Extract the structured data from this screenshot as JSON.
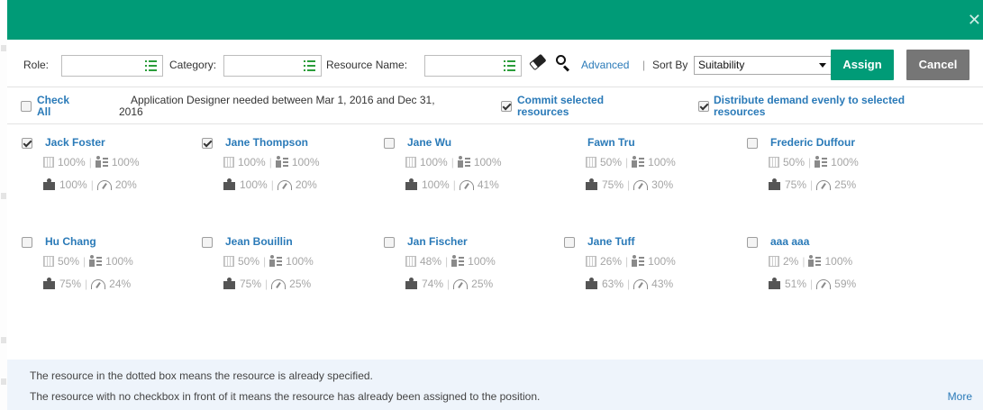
{
  "toolbar": {
    "role_label": "Role:",
    "category_label": "Category:",
    "resource_name_label": "Resource Name:",
    "advanced_label": "Advanced",
    "divider": "|",
    "sort_by_label": "Sort By",
    "sort_value": "Suitability",
    "assign_label": "Assign",
    "cancel_label": "Cancel",
    "icons": [
      "list-picker-icon",
      "eraser-icon",
      "search-icon"
    ]
  },
  "options": {
    "check_all_line1": "Check",
    "check_all_line2": "All",
    "demand_line1": "Application Designer needed between Mar 1, 2016 and Dec 31,",
    "demand_line2": "2016",
    "commit_line1": "Commit selected",
    "commit_line2": "resources",
    "commit_checked": true,
    "distribute_line1": "Distribute demand evenly to selected",
    "distribute_line2": "resources",
    "distribute_checked": true
  },
  "resources": [
    {
      "name": "Jack Foster",
      "checked": true,
      "has_checkbox": true,
      "availability": "100%",
      "skills": "100%",
      "match": "100%",
      "performance": "20%"
    },
    {
      "name": "Jane Thompson",
      "checked": true,
      "has_checkbox": true,
      "availability": "100%",
      "skills": "100%",
      "match": "100%",
      "performance": "20%"
    },
    {
      "name": "Jane Wu",
      "checked": false,
      "has_checkbox": true,
      "availability": "100%",
      "skills": "100%",
      "match": "100%",
      "performance": "41%"
    },
    {
      "name": "Fawn Tru",
      "checked": false,
      "has_checkbox": false,
      "availability": "50%",
      "skills": "100%",
      "match": "75%",
      "performance": "30%"
    },
    {
      "name": "Frederic Duffour",
      "checked": false,
      "has_checkbox": true,
      "availability": "50%",
      "skills": "100%",
      "match": "75%",
      "performance": "25%"
    },
    {
      "name": "Hu Chang",
      "checked": false,
      "has_checkbox": true,
      "availability": "50%",
      "skills": "100%",
      "match": "75%",
      "performance": "24%"
    },
    {
      "name": "Jean Bouillin",
      "checked": false,
      "has_checkbox": true,
      "availability": "50%",
      "skills": "100%",
      "match": "75%",
      "performance": "25%"
    },
    {
      "name": "Jan Fischer",
      "checked": false,
      "has_checkbox": true,
      "availability": "48%",
      "skills": "100%",
      "match": "74%",
      "performance": "25%"
    },
    {
      "name": "Jane Tuff",
      "checked": false,
      "has_checkbox": true,
      "availability": "26%",
      "skills": "100%",
      "match": "63%",
      "performance": "43%"
    },
    {
      "name": "aaa aaa",
      "checked": false,
      "has_checkbox": true,
      "availability": "2%",
      "skills": "100%",
      "match": "51%",
      "performance": "59%"
    }
  ],
  "footer": {
    "line1": "The resource in the dotted box means the resource is already specified.",
    "line2": "The resource with no checkbox in front of it means the resource has already been assigned to the position.",
    "more_label": "More"
  },
  "colors": {
    "header": "#009b77",
    "link": "#2a7ab8",
    "assign_button": "#009b77",
    "cancel_button": "#767676",
    "footer_bg": "#eef4fb"
  }
}
